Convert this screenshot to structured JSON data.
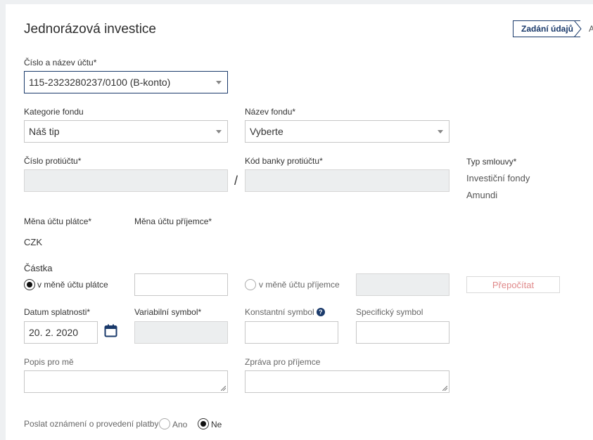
{
  "page": {
    "title": "Jednorázová investice"
  },
  "steps": {
    "active": "Zadání údajů",
    "next": "A"
  },
  "account": {
    "label": "Číslo a název účtu*",
    "value": "115-2323280237/0100 (B-konto)"
  },
  "fund_category": {
    "label": "Kategorie fondu",
    "value": "Náš tip"
  },
  "fund_name": {
    "label": "Název fondu*",
    "value": "Vyberte"
  },
  "counter_account": {
    "label": "Číslo protiúčtu*",
    "separator": "/"
  },
  "bank_code": {
    "label": "Kód banky protiúčtu*"
  },
  "contract": {
    "label": "Typ smlouvy*",
    "line1": "Investiční fondy",
    "line2": "Amundi"
  },
  "payer_currency": {
    "label": "Měna účtu plátce*",
    "value": "CZK"
  },
  "payee_currency": {
    "label": "Měna účtu příjemce*"
  },
  "amount": {
    "label": "Částka",
    "option_payer": "v měně účtu plátce",
    "option_payee": "v měně účtu příjemce",
    "recalc_button": "Přepočítat"
  },
  "due_date": {
    "label": "Datum splatnosti*",
    "value": "20. 2. 2020"
  },
  "variable_symbol": {
    "label": "Variabilní symbol*"
  },
  "constant_symbol": {
    "label": "Konstantní symbol",
    "help": "?"
  },
  "specific_symbol": {
    "label": "Specifický symbol"
  },
  "note_me": {
    "label": "Popis pro mě"
  },
  "note_payee": {
    "label": "Zpráva pro příjemce"
  },
  "notify": {
    "label": "Poslat oznámení o provedení platby",
    "yes": "Ano",
    "no": "Ne",
    "selected": "Ne"
  },
  "colors": {
    "accent": "#1a3a6b",
    "recalc_text": "#e0898a",
    "disabled_bg": "#eceeef"
  }
}
